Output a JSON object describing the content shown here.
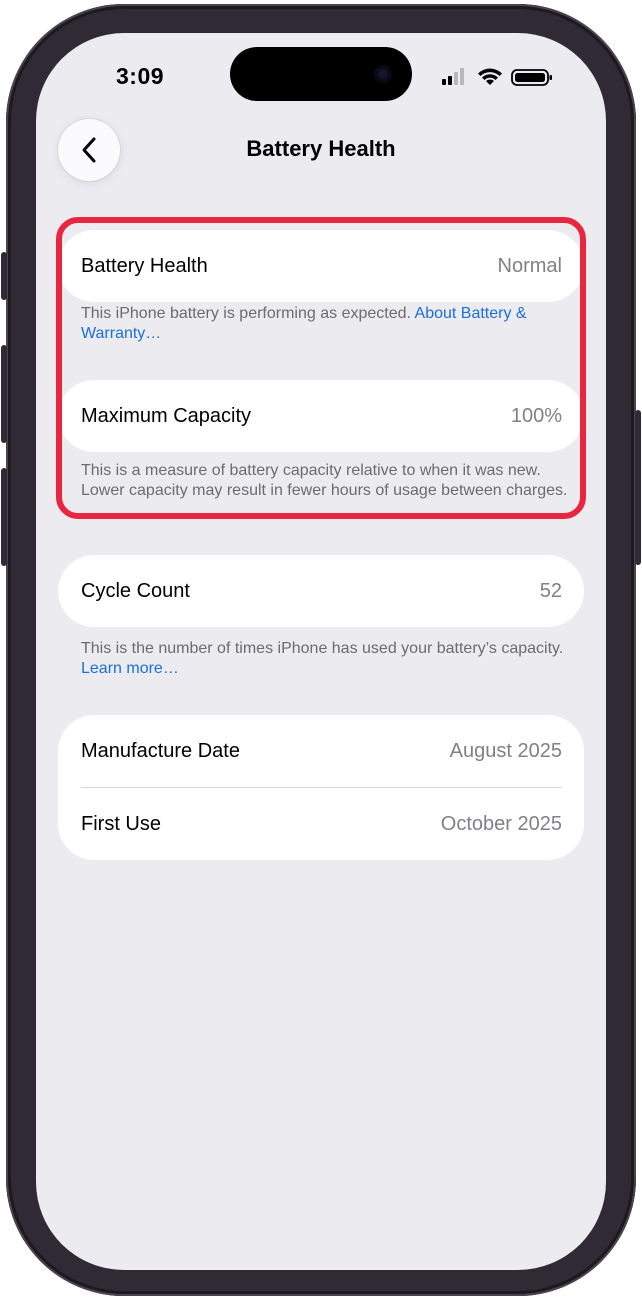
{
  "status_bar": {
    "time": "3:09"
  },
  "nav": {
    "title": "Battery Health"
  },
  "battery_health": {
    "label": "Battery Health",
    "value": "Normal",
    "footnote": "This iPhone battery is performing as expected.",
    "footnote_link": "About Battery & Warranty…"
  },
  "maximum_capacity": {
    "label": "Maximum Capacity",
    "value": "100%",
    "footnote": "This is a measure of battery capacity relative to when it was new. Lower capacity may result in fewer hours of usage between charges."
  },
  "cycle_count": {
    "label": "Cycle Count",
    "value": "52",
    "footnote": "This is the number of times iPhone has used your battery’s capacity.",
    "footnote_link": "Learn more…"
  },
  "dates": [
    {
      "label": "Manufacture Date",
      "value": "August 2025"
    },
    {
      "label": "First Use",
      "value": "October 2025"
    }
  ],
  "colors": {
    "highlight": "#e8263f",
    "link": "#1a6fd8",
    "background": "#ecebf0"
  }
}
